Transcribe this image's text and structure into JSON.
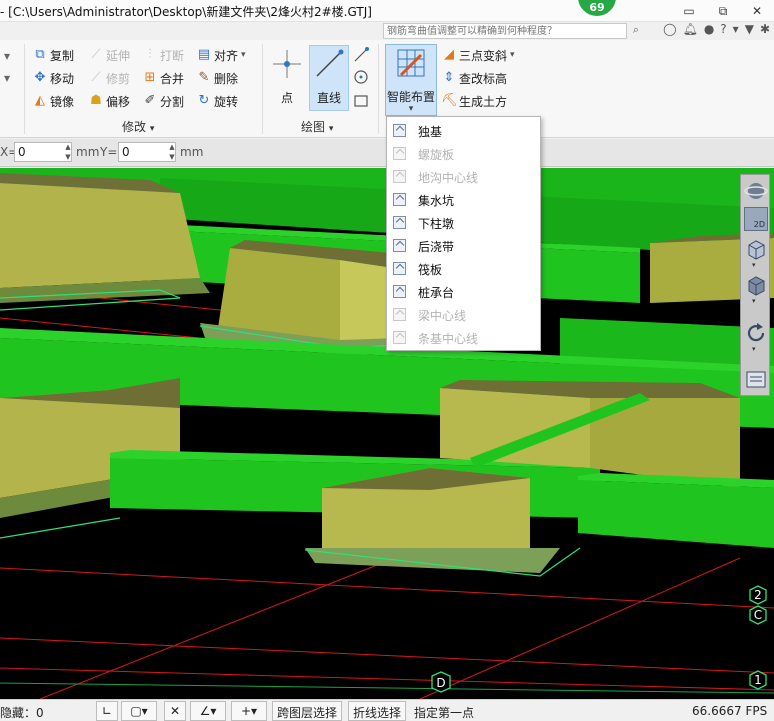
{
  "window": {
    "title": "- [C:\\Users\\Administrator\\Desktop\\新建文件夹\\2烽火村2#楼.GTJ]",
    "badge": "69",
    "buttons": [
      "▭",
      "⧉",
      "✕"
    ]
  },
  "help": {
    "search_placeholder": "钢筋弯曲值调整可以精确到何种程度？",
    "question": "?"
  },
  "ribbon": {
    "modify_group": {
      "label": "修改",
      "items": [
        {
          "label": "复制",
          "enabled": true
        },
        {
          "label": "延伸",
          "enabled": false
        },
        {
          "label": "打断",
          "enabled": false
        },
        {
          "label": "对齐",
          "enabled": true
        },
        {
          "label": "移动",
          "enabled": true
        },
        {
          "label": "修剪",
          "enabled": false
        },
        {
          "label": "合并",
          "enabled": true
        },
        {
          "label": "删除",
          "enabled": true
        },
        {
          "label": "镜像",
          "enabled": true
        },
        {
          "label": "偏移",
          "enabled": true
        },
        {
          "label": "分割",
          "enabled": true
        },
        {
          "label": "旋转",
          "enabled": true
        }
      ]
    },
    "draw_group": {
      "label": "绘图",
      "point": "点",
      "line": "直线"
    },
    "smart_group": {
      "smart_layout": "智能布置",
      "three_point_slope": "三点变斜",
      "check_elevation": "查改标高",
      "generate_earthwork": "生成土方"
    }
  },
  "coord": {
    "x_label": "X=",
    "x_value": "0",
    "x_unit": "mm",
    "y_label": "Y=",
    "y_value": "0",
    "y_unit": "mm"
  },
  "dropdown": {
    "items": [
      {
        "label": "独基",
        "enabled": true
      },
      {
        "label": "螺旋板",
        "enabled": false
      },
      {
        "label": "地沟中心线",
        "enabled": false
      },
      {
        "label": "集水坑",
        "enabled": true
      },
      {
        "label": "下柱墩",
        "enabled": true
      },
      {
        "label": "后浇带",
        "enabled": true
      },
      {
        "label": "筏板",
        "enabled": true
      },
      {
        "label": "桩承台",
        "enabled": true
      },
      {
        "label": "梁中心线",
        "enabled": false
      },
      {
        "label": "条基中心线",
        "enabled": false
      }
    ]
  },
  "viewport": {
    "axis_labels": [
      "2",
      "C",
      "1",
      "D"
    ],
    "view_tools": [
      "2D"
    ]
  },
  "status": {
    "hidden_label": "隐藏：0",
    "cross_layer": "跨图层选择",
    "polyline_select": "折线选择",
    "prompt": "指定第一点",
    "fps": "66.6667 FPS"
  }
}
